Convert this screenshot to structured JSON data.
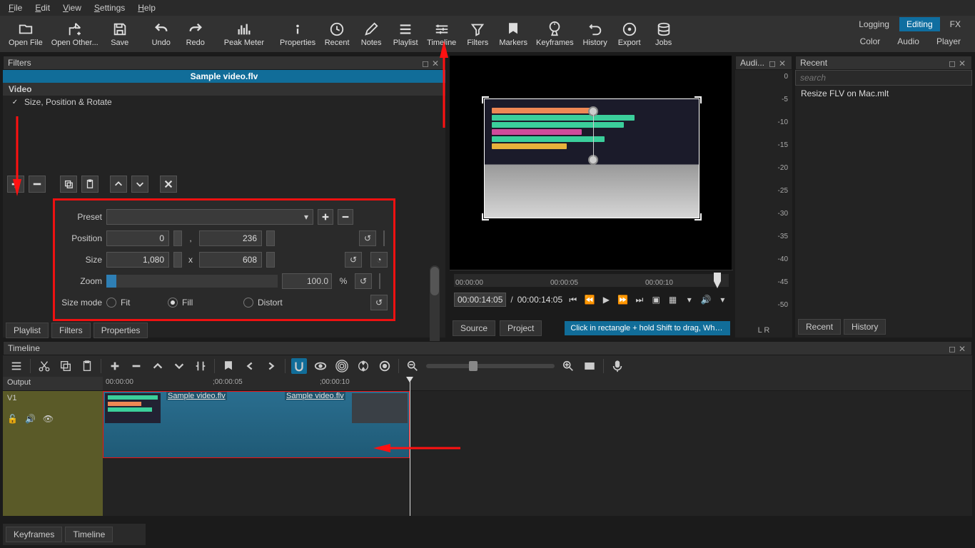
{
  "menubar": [
    "File",
    "Edit",
    "View",
    "Settings",
    "Help"
  ],
  "toolbar": [
    {
      "id": "open-file",
      "label": "Open File"
    },
    {
      "id": "open-other",
      "label": "Open Other..."
    },
    {
      "id": "save",
      "label": "Save"
    },
    {
      "id": "undo",
      "label": "Undo"
    },
    {
      "id": "redo",
      "label": "Redo"
    },
    {
      "id": "peak-meter",
      "label": "Peak Meter"
    },
    {
      "id": "properties",
      "label": "Properties"
    },
    {
      "id": "recent",
      "label": "Recent"
    },
    {
      "id": "notes",
      "label": "Notes"
    },
    {
      "id": "playlist",
      "label": "Playlist"
    },
    {
      "id": "timeline",
      "label": "Timeline"
    },
    {
      "id": "filters",
      "label": "Filters"
    },
    {
      "id": "markers",
      "label": "Markers"
    },
    {
      "id": "keyframes",
      "label": "Keyframes"
    },
    {
      "id": "history",
      "label": "History"
    },
    {
      "id": "export",
      "label": "Export"
    },
    {
      "id": "jobs",
      "label": "Jobs"
    }
  ],
  "modes_row1": [
    {
      "label": "Logging",
      "active": false
    },
    {
      "label": "Editing",
      "active": true
    },
    {
      "label": "FX",
      "active": false
    }
  ],
  "modes_row2": [
    {
      "label": "Color",
      "active": false
    },
    {
      "label": "Audio",
      "active": false
    },
    {
      "label": "Player",
      "active": false
    }
  ],
  "filters": {
    "panel_title": "Filters",
    "clip_title": "Sample video.flv",
    "section_label": "Video",
    "item": "Size, Position & Rotate",
    "params": {
      "preset_label": "Preset",
      "preset_value": "",
      "position_label": "Position",
      "position_x": "0",
      "position_y": "236",
      "size_label": "Size",
      "size_w": "1,080",
      "size_h": "608",
      "zoom_label": "Zoom",
      "zoom_value": "100.0",
      "zoom_unit": "%",
      "sizemode_label": "Size mode",
      "mode_fit": "Fit",
      "mode_fill": "Fill",
      "mode_distort": "Distort",
      "mode_selected": "Fill"
    }
  },
  "lower_tabs": [
    "Playlist",
    "Filters",
    "Properties"
  ],
  "preview": {
    "scrub_ticks": [
      "00:00:00",
      "00:00:05",
      "00:00:10"
    ],
    "current_tc": "00:00:14:05",
    "total_tc": "00:00:14:05",
    "source_label": "Source",
    "project_label": "Project",
    "hint": "Click in rectangle + hold Shift to drag, Wheel to zoom,..."
  },
  "audio": {
    "title": "Audi...",
    "ticks": [
      "0",
      "-5",
      "-10",
      "-15",
      "-20",
      "-25",
      "-30",
      "-35",
      "-40",
      "-45",
      "-50"
    ],
    "lr": "L   R"
  },
  "recent": {
    "title": "Recent",
    "search_placeholder": "search",
    "items": [
      "Resize FLV on Mac.mlt"
    ],
    "tabs": [
      "Recent",
      "History"
    ]
  },
  "timeline": {
    "title": "Timeline",
    "output_label": "Output",
    "track_label": "V1",
    "ruler": [
      "00:00:00",
      ";00:00:05",
      ";00:00:10"
    ],
    "clip_label": "Sample video.flv",
    "bottom_tabs": [
      "Keyframes",
      "Timeline"
    ]
  }
}
